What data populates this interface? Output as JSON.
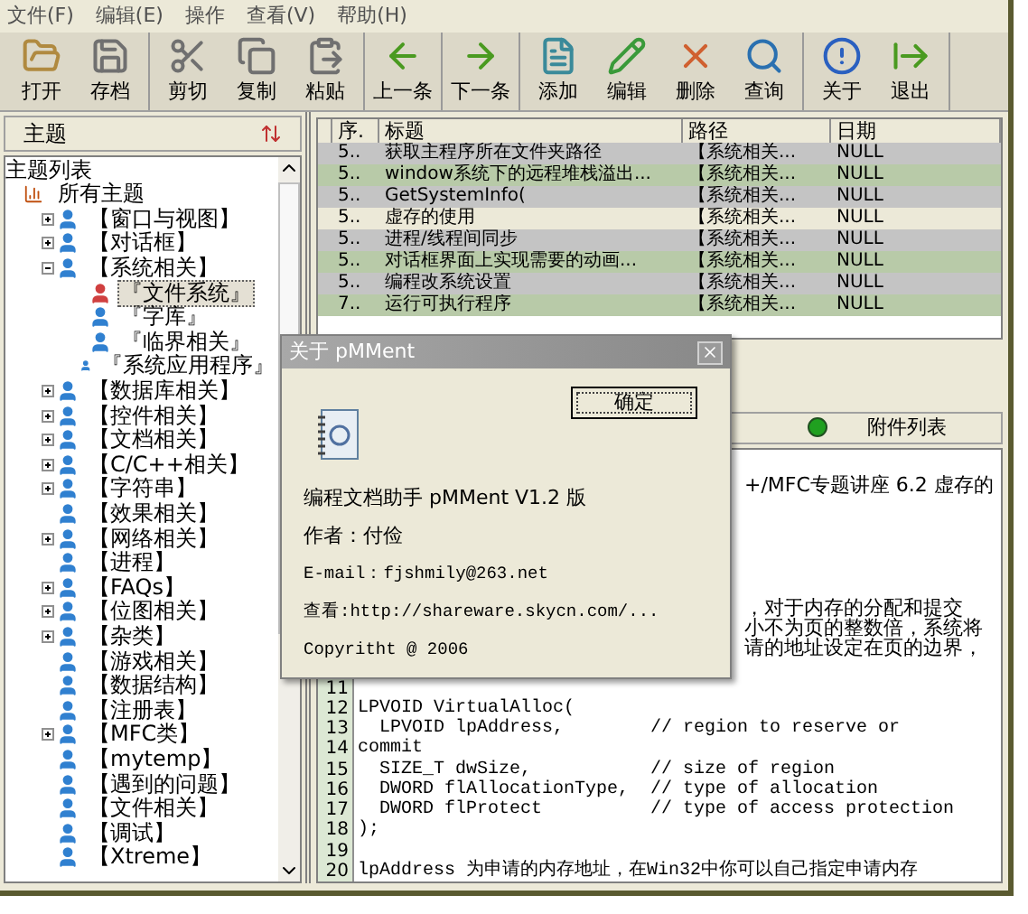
{
  "menu": [
    "文件(F)",
    "编辑(E)",
    "操作",
    "查看(V)",
    "帮助(H)"
  ],
  "toolbar": {
    "groups": [
      [
        {
          "label": "打开"
        },
        {
          "label": "存档"
        }
      ],
      [
        {
          "label": "剪切"
        },
        {
          "label": "复制"
        },
        {
          "label": "粘贴"
        }
      ],
      [
        {
          "label": "上一条"
        }
      ],
      [
        {
          "label": "下一条"
        }
      ],
      [
        {
          "label": "添加"
        },
        {
          "label": "编辑"
        },
        {
          "label": "删除"
        },
        {
          "label": "查询"
        }
      ],
      [
        {
          "label": "关于"
        },
        {
          "label": "退出"
        }
      ]
    ]
  },
  "topic_panel": {
    "title": "主题",
    "tree_title": "主题列表",
    "tree": [
      {
        "label": "所有主题",
        "kind": "root",
        "children": [
          {
            "label": "【窗口与视图】",
            "expanded": false,
            "selected": false
          },
          {
            "label": "【对话框】",
            "expanded": false,
            "selected": false
          },
          {
            "label": "【系统相关】",
            "expanded": true,
            "selected": false,
            "children": [
              {
                "label": "『文件系统』",
                "selected": true
              },
              {
                "label": "『字库』",
                "selected": false
              },
              {
                "label": "『临界相关』",
                "selected": false
              },
              {
                "label": "『系统应用程序』",
                "selected": false
              }
            ]
          },
          {
            "label": "【数据库相关】",
            "expanded": false,
            "selected": false
          },
          {
            "label": "【控件相关】",
            "expanded": false,
            "selected": false
          },
          {
            "label": "【文档相关】",
            "expanded": false,
            "selected": false
          },
          {
            "label": "【C/C++相关】",
            "expanded": false,
            "selected": false
          },
          {
            "label": "【字符串】",
            "expanded": false,
            "selected": false
          },
          {
            "label": "【效果相关】",
            "selected": false
          },
          {
            "label": "【网络相关】",
            "expanded": false,
            "selected": false
          },
          {
            "label": "【进程】",
            "selected": false
          },
          {
            "label": "【FAQs】",
            "expanded": false,
            "selected": false
          },
          {
            "label": "【位图相关】",
            "expanded": false,
            "selected": false
          },
          {
            "label": "【杂类】",
            "expanded": false,
            "selected": false
          },
          {
            "label": "【游戏相关】",
            "selected": false
          },
          {
            "label": "【数据结构】",
            "selected": false
          },
          {
            "label": "【注册表】",
            "selected": false
          },
          {
            "label": "【MFC类】",
            "expanded": false,
            "selected": false
          },
          {
            "label": "【mytemp】",
            "selected": false
          },
          {
            "label": "【遇到的问题】",
            "selected": false
          },
          {
            "label": "【文件相关】",
            "selected": false
          },
          {
            "label": "【调试】",
            "selected": false
          },
          {
            "label": "【Xtreme】",
            "selected": false
          }
        ]
      }
    ]
  },
  "table": {
    "columns": [
      "序.",
      "标题",
      "路径",
      "日期"
    ],
    "rows": [
      {
        "cells": [
          "5..",
          "获取主程序所在文件夹路径",
          "【系统相关...",
          "NULL"
        ],
        "selected": false
      },
      {
        "cells": [
          "5..",
          "window系统下的远程堆栈溢出...",
          "【系统相关...",
          "NULL"
        ],
        "selected": false
      },
      {
        "cells": [
          "5..",
          "GetSystemInfo(",
          "【系统相关...",
          "NULL"
        ],
        "selected": false
      },
      {
        "cells": [
          "5..",
          "虚存的使用",
          "【系统相关...",
          "NULL"
        ],
        "selected": true
      },
      {
        "cells": [
          "5..",
          "进程/线程间同步",
          "【系统相关...",
          "NULL"
        ],
        "selected": false
      },
      {
        "cells": [
          "5..",
          "对话框界面上实现需要的动画...",
          "【系统相关...",
          "NULL"
        ],
        "selected": false
      },
      {
        "cells": [
          "5..",
          "编程改系统设置",
          "【系统相关...",
          "NULL"
        ],
        "selected": false
      },
      {
        "cells": [
          "7..",
          "运行可执行程序",
          "【系统相关...",
          "NULL"
        ],
        "selected": false
      }
    ]
  },
  "attachments": {
    "label": "附件列表"
  },
  "editor": {
    "lines": [
      {
        "kind": "covered",
        "text": "+/MFC专题讲座 6.2 虚存的"
      },
      {
        "kind": "covered"
      },
      {
        "kind": "covered"
      },
      {
        "kind": "covered"
      },
      {
        "kind": "covered"
      },
      {
        "kind": "covered"
      },
      {
        "kind": "covered",
        "text": "，对于内存的分配和提交"
      },
      {
        "kind": "covered",
        "text": "小不为页的整数倍，系统将"
      },
      {
        "kind": "covered",
        "text": "请的地址设定在页的边界，"
      },
      {
        "kind": "covered"
      },
      {
        "kind": "code",
        "number": "11"
      },
      {
        "kind": "code",
        "number": "12",
        "text": "LPVOID VirtualAlloc("
      },
      {
        "kind": "code",
        "number": "13",
        "text": "  LPVOID lpAddress,        // region to reserve or"
      },
      {
        "kind": "code",
        "number": "14",
        "text": "commit"
      },
      {
        "kind": "code",
        "number": "15",
        "text": "  SIZE_T dwSize,           // size of region"
      },
      {
        "kind": "code",
        "number": "16",
        "text": "  DWORD flAllocationType,  // type of allocation"
      },
      {
        "kind": "code",
        "number": "17",
        "text": "  DWORD flProtect          // type of access protection"
      },
      {
        "kind": "code",
        "number": "18",
        "text": ");"
      },
      {
        "kind": "code",
        "number": "19"
      },
      {
        "kind": "code",
        "number": "20",
        "text": "lpAddress 为申请的内存地址，在Win32中你可以自己指定申请内存"
      }
    ]
  },
  "about_dialog": {
    "title": "关于 pMMent",
    "button": "确定",
    "lines": [
      "编程文档助手 pMMent V1.2 版",
      "作者：付俭",
      "E-mail：fjshmily@263.net",
      "查看:http://shareware.skycn.com/...",
      "Copyritht @ 2006"
    ]
  }
}
